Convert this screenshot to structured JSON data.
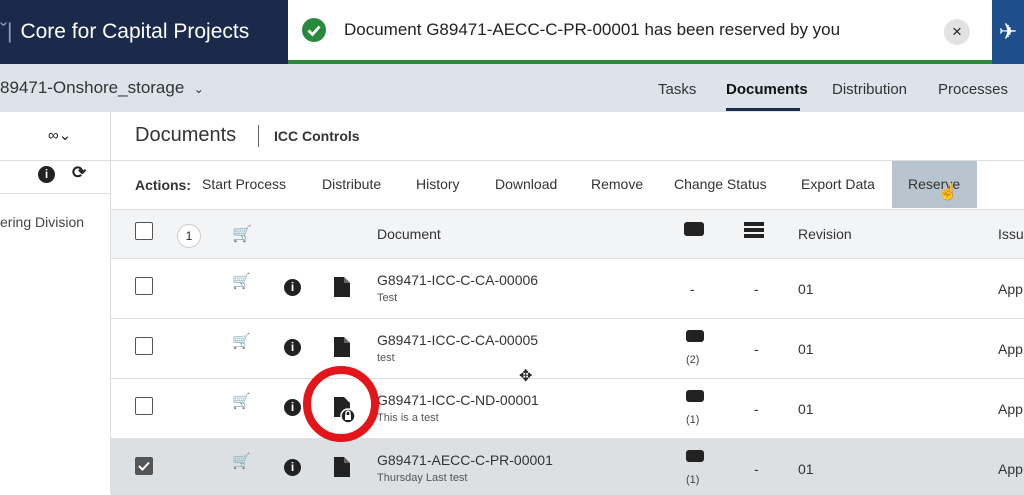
{
  "header": {
    "app_title": "Core for Capital Projects",
    "toast_message": "Document G89471-AECC-C-PR-00001 has been reserved by you",
    "close_glyph": "×"
  },
  "project": {
    "name": "89471-Onshore_storage",
    "nav": [
      "Tasks",
      "Documents",
      "Distribution",
      "Processes"
    ]
  },
  "left_panel": {
    "division_label": "ering Division"
  },
  "documents": {
    "title": "Documents",
    "subtitle": "ICC Controls"
  },
  "actions": {
    "label": "Actions:",
    "items": [
      "Start Process",
      "Distribute",
      "History",
      "Download",
      "Remove",
      "Change Status",
      "Export Data",
      "Reserve"
    ]
  },
  "table": {
    "selected_count": "1",
    "columns": {
      "document": "Document",
      "revision": "Revision",
      "issue": "Issu"
    },
    "rows": [
      {
        "number": "G89471-ICC-C-CA-00006",
        "description": "Test",
        "comments": "-",
        "comment_count": "",
        "dist": "-",
        "revision": "01",
        "issue": "App",
        "checked": false,
        "locked": false
      },
      {
        "number": "G89471-ICC-C-CA-00005",
        "description": "test",
        "comments": "",
        "comment_count": "(2)",
        "dist": "-",
        "revision": "01",
        "issue": "App",
        "checked": false,
        "locked": false
      },
      {
        "number": "G89471-ICC-C-ND-00001",
        "description": "This is a test",
        "comments": "",
        "comment_count": "(1)",
        "dist": "-",
        "revision": "01",
        "issue": "App",
        "checked": false,
        "locked": true
      },
      {
        "number": "G89471-AECC-C-PR-00001",
        "description": "Thursday Last test",
        "comments": "",
        "comment_count": "(1)",
        "dist": "-",
        "revision": "01",
        "issue": "App",
        "checked": true,
        "locked": false
      }
    ]
  },
  "colors": {
    "topbar": "#1b2a4a",
    "success": "#2a8a3c",
    "highlight": "#e3151a",
    "reserve_hover": "#b8c5cf"
  }
}
